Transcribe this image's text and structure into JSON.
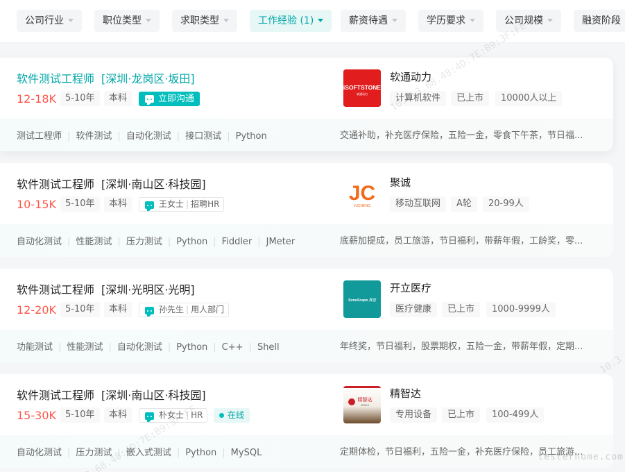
{
  "filters": [
    {
      "label": "公司行业",
      "active": false
    },
    {
      "label": "职位类型",
      "active": false
    },
    {
      "label": "求职类型",
      "active": false
    },
    {
      "label": "工作经验 (1)",
      "active": true
    },
    {
      "label": "薪资待遇",
      "active": false
    },
    {
      "label": "学历要求",
      "active": false
    },
    {
      "label": "公司规模",
      "active": false
    },
    {
      "label": "融资阶段",
      "active": false
    }
  ],
  "jobs": [
    {
      "title": "软件测试工程师",
      "area": "[深圳·龙岗区·坂田]",
      "salary": "12-18K",
      "experience": "5-10年",
      "degree": "本科",
      "chat_label": "立即沟通",
      "skills": [
        "测试工程师",
        "软件测试",
        "自动化测试",
        "接口测试",
        "Python"
      ],
      "benefits": "交通补助，补充医疗保险，五险一金，零食下午茶，节日福...",
      "company": {
        "name": "软通动力",
        "logo_text": "iSOFTSTONE",
        "logo_subtext": "软通动力",
        "tags": [
          "计算机软件",
          "已上市",
          "10000人以上"
        ]
      }
    },
    {
      "title": "软件测试工程师",
      "area": "[深圳·南山区·科技园]",
      "salary": "10-15K",
      "experience": "5-10年",
      "degree": "本科",
      "hr": {
        "name": "王女士",
        "role": "招聘HR"
      },
      "skills": [
        "自动化测试",
        "性能测试",
        "压力测试",
        "Python",
        "Fiddler",
        "JMeter"
      ],
      "benefits": "底薪加提成，员工旅游，节日福利，带薪年假，工龄奖，零...",
      "company": {
        "name": "聚诚",
        "logo_text": "JC",
        "logo_subtext": "JUCHENG",
        "tags": [
          "移动互联网",
          "A轮",
          "20-99人"
        ]
      }
    },
    {
      "title": "软件测试工程师",
      "area": "[深圳·光明区·光明]",
      "salary": "12-20K",
      "experience": "5-10年",
      "degree": "本科",
      "hr": {
        "name": "孙先生",
        "role": "用人部门"
      },
      "skills": [
        "功能测试",
        "性能测试",
        "自动化测试",
        "Python",
        "C++",
        "Shell"
      ],
      "benefits": "年终奖，节日福利，股票期权，五险一金，带薪年假，定期...",
      "company": {
        "name": "开立医疗",
        "logo_text": "SonoScape 开立",
        "logo_subtext": "",
        "tags": [
          "医疗健康",
          "已上市",
          "1000-9999人"
        ]
      }
    },
    {
      "title": "软件测试工程师",
      "area": "[深圳·南山区·科技园]",
      "salary": "15-30K",
      "experience": "5-10年",
      "degree": "本科",
      "hr": {
        "name": "朴女士",
        "role": "HR"
      },
      "online_label": "在线",
      "skills": [
        "自动化测试",
        "压力测试",
        "嵌入式测试",
        "Python",
        "MySQL"
      ],
      "benefits": "定期体检，节日福利，五险一金，补充医疗保险，员工旅游...",
      "company": {
        "name": "精智达",
        "logo_text": "精智达",
        "logo_subtext": "SEICHI",
        "tags": [
          "专用设备",
          "已上市",
          "100-499人"
        ]
      }
    }
  ],
  "watermark": {
    "text_a": "10.3.3.68.48:4D:7E:B9:3F:FE",
    "text_b": "3.68.48:4D:7E:B9:3F:FE",
    "text_c": "10.3"
  },
  "site_mark": "testerhome.com",
  "colors": {
    "accent": "#00bebd",
    "accent_text": "#00a6a7",
    "salary": "#fe574a"
  }
}
